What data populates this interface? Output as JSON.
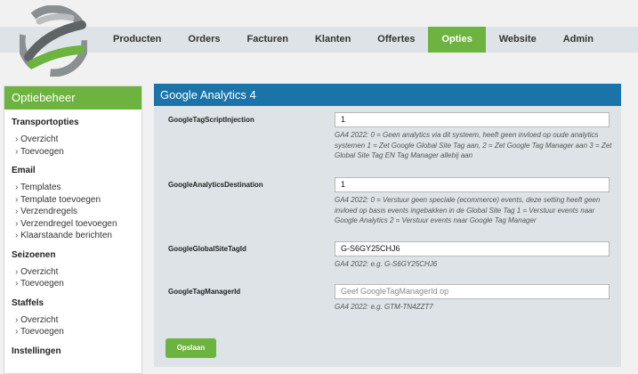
{
  "nav": {
    "items": [
      {
        "label": "Producten"
      },
      {
        "label": "Orders"
      },
      {
        "label": "Facturen"
      },
      {
        "label": "Klanten"
      },
      {
        "label": "Offertes"
      },
      {
        "label": "Opties",
        "active": true
      },
      {
        "label": "Website"
      },
      {
        "label": "Admin"
      }
    ]
  },
  "sidebar": {
    "title": "Optiebeheer",
    "sections": [
      {
        "title": "Transportopties",
        "items": [
          "Overzicht",
          "Toevoegen"
        ]
      },
      {
        "title": "Email",
        "items": [
          "Templates",
          "Template toevoegen",
          "Verzendregels",
          "Verzendregel toevoegen",
          "Klaarstaande berichten"
        ]
      },
      {
        "title": "Seizoenen",
        "items": [
          "Overzicht",
          "Toevoegen"
        ]
      },
      {
        "title": "Staffels",
        "items": [
          "Overzicht",
          "Toevoegen"
        ]
      },
      {
        "title": "Instellingen",
        "items": []
      }
    ]
  },
  "panel": {
    "title": "Google Analytics 4",
    "fields": [
      {
        "label": "GoogleTagScriptInjection",
        "value": "1",
        "placeholder": "",
        "help": "GA4 2022: 0 = Geen analytics via dit systeem, heeft geen invloed op oude analytics systemen 1 = Zet Google Global Site Tag aan, 2 = Zet Google Tag Manager aan 3 = Zet Global Site Tag EN Tag Manager allebij aan"
      },
      {
        "label": "GoogleAnalyticsDestination",
        "value": "1",
        "placeholder": "",
        "help": "GA4 2022: 0 = Verstuur geen speciale (ecommerce) events, deze setting heeft geen invloed op basis events ingebakken in de Global Site Tag 1 = Verstuur events naar Google Analytics 2 = Verstuur events naar Google Tag Manager"
      },
      {
        "label": "GoogleGlobalSiteTagId",
        "value": "G-S6GY25CHJ6",
        "placeholder": "",
        "help": "GA4 2022: e.g. G-S6GY25CHJ6"
      },
      {
        "label": "GoogleTagManagerId",
        "value": "",
        "placeholder": "Geef GoogleTagManagerId op",
        "help": "GA4 2022: e.g. GTM-TN4ZZT7"
      }
    ],
    "save_label": "Opslaan"
  },
  "colors": {
    "accent_green": "#6cb33f",
    "header_blue": "#1a74a9",
    "panel_bg": "#dde3e6"
  }
}
